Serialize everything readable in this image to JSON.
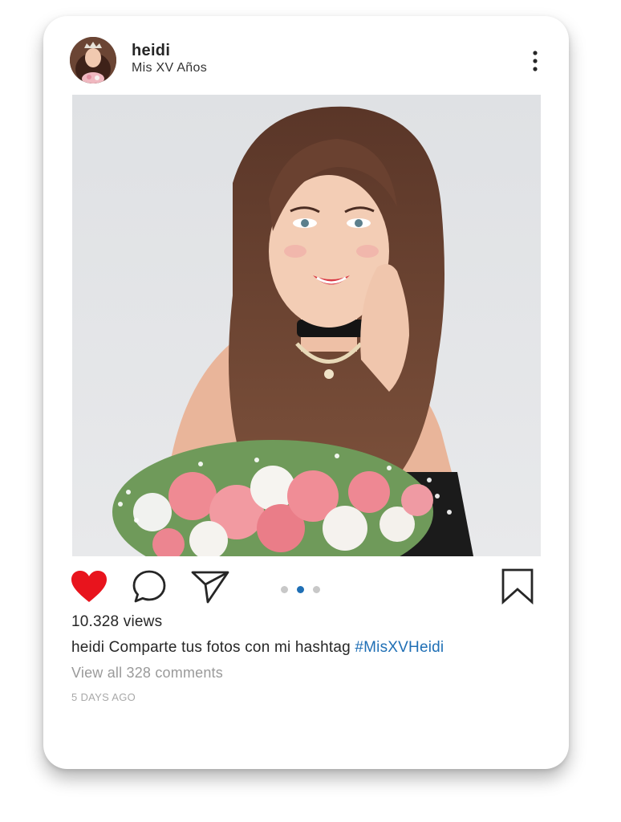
{
  "post": {
    "username": "heidi",
    "subtitle": "Mis XV Años",
    "views": "10.328 views",
    "caption_user": "heidi",
    "caption_text": " Comparte tus fotos con mi hashtag ",
    "caption_hashtag": "#MisXVHeidi",
    "view_comments": "View all 328 comments",
    "time_ago": "5 DAYS AGO",
    "liked": true,
    "carousel_index": 2,
    "carousel_count": 3
  },
  "icons": {
    "more": "more-vertical-icon",
    "like": "heart-icon",
    "comment": "comment-icon",
    "share": "send-icon",
    "save": "bookmark-icon"
  },
  "colors": {
    "like": "#e8141d",
    "hashtag": "#1f6fb5",
    "dot_active": "#1f6fb5",
    "dot_inactive": "#c8c8c8"
  }
}
